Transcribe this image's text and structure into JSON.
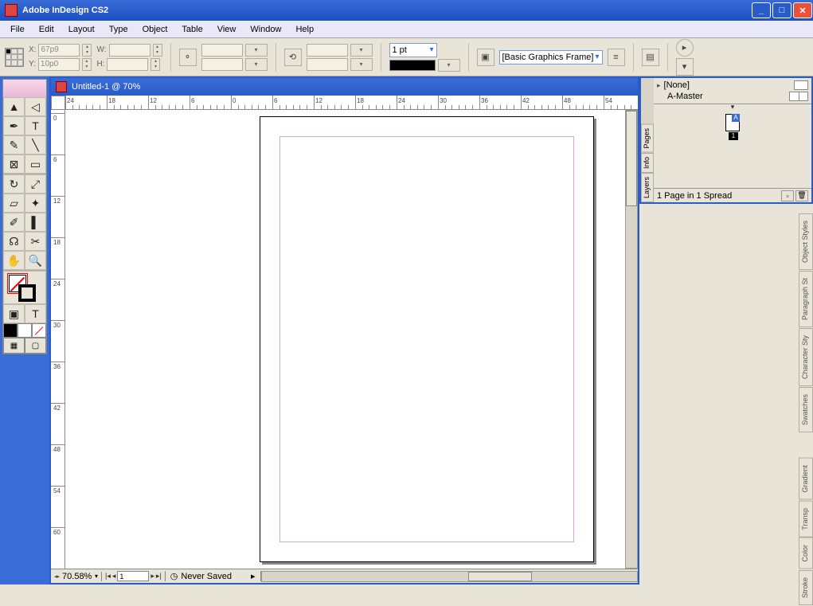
{
  "app": {
    "title": "Adobe InDesign CS2"
  },
  "menu": [
    "File",
    "Edit",
    "Layout",
    "Type",
    "Object",
    "Table",
    "View",
    "Window",
    "Help"
  ],
  "control": {
    "x_label": "X:",
    "x_value": "67p9",
    "y_label": "Y:",
    "y_value": "10p0",
    "w_label": "W:",
    "w_value": "",
    "h_label": "H:",
    "h_value": "",
    "stroke_weight": "1 pt",
    "object_style": "[Basic Graphics Frame]"
  },
  "document": {
    "title": "Untitled-1 @ 70%",
    "zoom": "70.58%",
    "page_num": "1",
    "save_status": "Never Saved",
    "ruler_h": [
      "24",
      "18",
      "12",
      "6",
      "0",
      "6",
      "12",
      "18",
      "24",
      "30",
      "36",
      "42",
      "48",
      "54"
    ],
    "ruler_v": [
      "0",
      "6",
      "12",
      "18",
      "24",
      "30",
      "36",
      "42",
      "48",
      "54",
      "60"
    ]
  },
  "pages_panel": {
    "none": "[None]",
    "master": "A-Master",
    "thumb_a": "A",
    "thumb_1": "1",
    "footer": "1 Page in 1 Spread",
    "tabs": [
      "Pages",
      "Info",
      "Layers"
    ]
  },
  "side_tabs": [
    "Object Styles",
    "Paragraph St",
    "Character Sty",
    "Swatches",
    "Gradient",
    "Transp",
    "Color",
    "Stroke"
  ]
}
